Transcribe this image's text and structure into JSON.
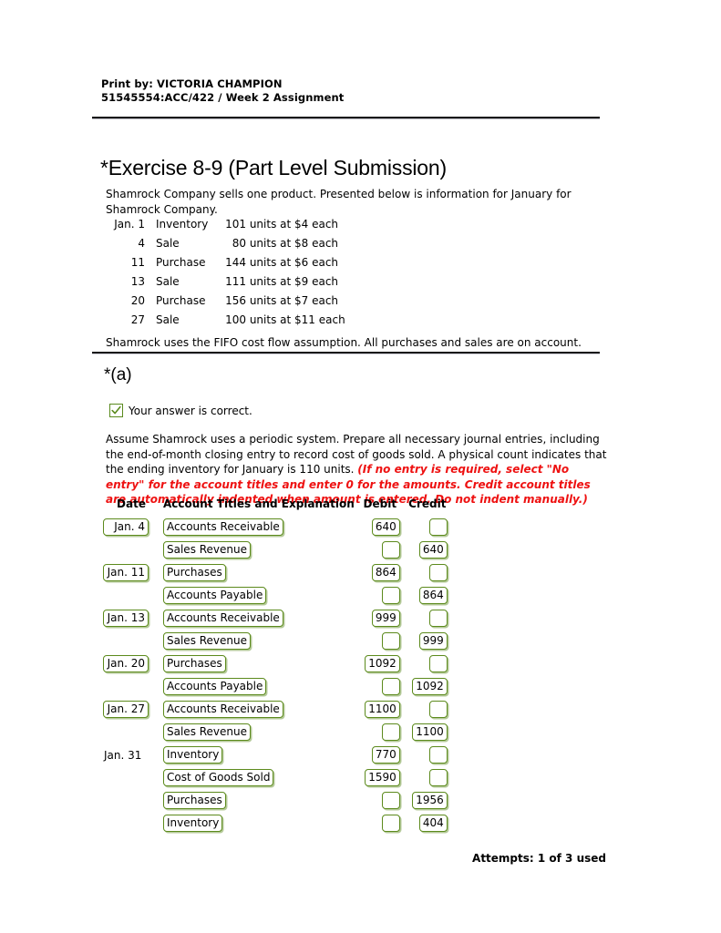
{
  "print_header": {
    "line1": "Print by: VICTORIA CHAMPION",
    "line2": "51545554:ACC/422 / Week 2 Assignment"
  },
  "exercise": {
    "title": "*Exercise 8-9 (Part Level Submission)",
    "intro": "Shamrock Company sells one product. Presented below is information for January for Shamrock Company.",
    "fifo_note": "Shamrock uses the FIFO cost flow assumption. All purchases and sales are on account."
  },
  "transactions": [
    {
      "date": "Jan. 1",
      "type": "Inventory",
      "units": "101",
      "rest": "units at $4 each"
    },
    {
      "date": "4",
      "type": "Sale",
      "units": "80",
      "rest": "units at $8 each"
    },
    {
      "date": "11",
      "type": "Purchase",
      "units": "144",
      "rest": "units at $6 each"
    },
    {
      "date": "13",
      "type": "Sale",
      "units": "111",
      "rest": "units at $9 each"
    },
    {
      "date": "20",
      "type": "Purchase",
      "units": "156",
      "rest": "units at $7 each"
    },
    {
      "date": "27",
      "type": "Sale",
      "units": "100",
      "rest": "units at $11 each"
    }
  ],
  "part": {
    "label": "*(a)",
    "status_text": "Your answer is correct.",
    "status_icon": "check-icon",
    "instructions_plain": "Assume Shamrock uses a periodic system. Prepare all necessary journal entries, including the end-of-month closing entry to record cost of goods sold. A physical count indicates that the ending inventory for January is 110 units. ",
    "instructions_emphasis": "(If no entry is required, select \"No entry\" for the account titles and enter 0 for the amounts. Credit account titles are automatically indented when amount is entered. Do not indent manually.)",
    "emphasis_color": "#ee1111"
  },
  "journal": {
    "headers": {
      "date": "Date",
      "account": "Account Titles and Explanation",
      "debit": "Debit",
      "credit": "Credit"
    },
    "rows": [
      {
        "date": "Jan. 4",
        "date_boxed": true,
        "account": "Accounts Receivable",
        "debit": "640",
        "credit": ""
      },
      {
        "date": "",
        "date_boxed": false,
        "account": "Sales Revenue",
        "debit": "",
        "credit": "640"
      },
      {
        "date": "Jan. 11",
        "date_boxed": true,
        "account": "Purchases",
        "debit": "864",
        "credit": ""
      },
      {
        "date": "",
        "date_boxed": false,
        "account": "Accounts Payable",
        "debit": "",
        "credit": "864"
      },
      {
        "date": "Jan. 13",
        "date_boxed": true,
        "account": "Accounts Receivable",
        "debit": "999",
        "credit": ""
      },
      {
        "date": "",
        "date_boxed": false,
        "account": "Sales Revenue",
        "debit": "",
        "credit": "999"
      },
      {
        "date": "Jan. 20",
        "date_boxed": true,
        "account": "Purchases",
        "debit": "1092",
        "credit": ""
      },
      {
        "date": "",
        "date_boxed": false,
        "account": "Accounts Payable",
        "debit": "",
        "credit": "1092"
      },
      {
        "date": "Jan. 27",
        "date_boxed": true,
        "account": "Accounts Receivable",
        "debit": "1100",
        "credit": ""
      },
      {
        "date": "",
        "date_boxed": false,
        "account": "Sales Revenue",
        "debit": "",
        "credit": "1100"
      },
      {
        "date": "Jan. 31",
        "date_boxed": false,
        "account": "Inventory",
        "debit": "770",
        "credit": ""
      },
      {
        "date": "",
        "date_boxed": false,
        "account": "Cost of Goods Sold",
        "debit": "1590",
        "credit": ""
      },
      {
        "date": "",
        "date_boxed": false,
        "account": "Purchases",
        "debit": "",
        "credit": "1956"
      },
      {
        "date": "",
        "date_boxed": false,
        "account": "Inventory",
        "debit": "",
        "credit": "404"
      }
    ]
  },
  "footer": {
    "attempts": "Attempts: 1 of 3 used"
  },
  "colors": {
    "correct_green": "#5c8a1c",
    "emphasis_red": "#ee1111",
    "rule_dark": "#1a1a1a"
  }
}
